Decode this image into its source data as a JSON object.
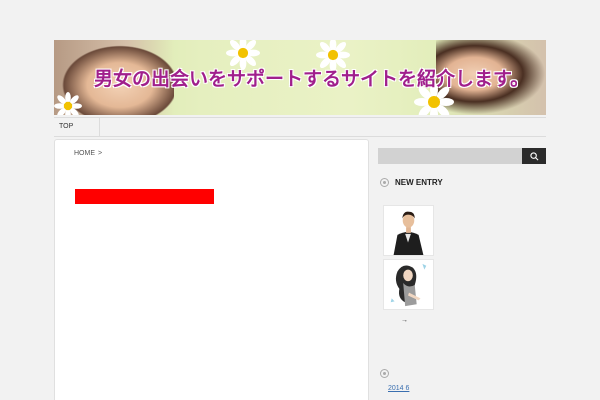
{
  "banner": {
    "text": "男女の出会いをサポートするサイトを紹介します。"
  },
  "nav": {
    "items": [
      {
        "label": "TOP"
      }
    ]
  },
  "main": {
    "breadcrumb": {
      "home": "HOME",
      "separator": ">"
    }
  },
  "sidebar": {
    "search": {
      "placeholder": "",
      "icon": "search-icon"
    },
    "new_entry": {
      "title": "NEW ENTRY",
      "arrow": "→"
    },
    "archive": {
      "link": "2014 6"
    }
  },
  "colors": {
    "banner_text": "#a01f8c",
    "highlight_bar": "#ff0000",
    "search_button": "#2b2b2b",
    "link": "#3a6fb0"
  }
}
